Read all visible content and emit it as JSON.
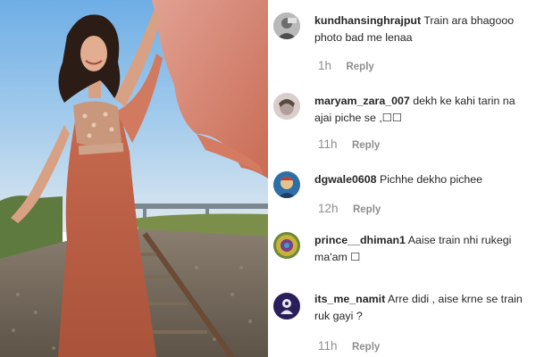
{
  "photo": {
    "description_icon": "woman-in-saree-on-railway-track-photo"
  },
  "comments": [
    {
      "username": "kundhansinghrajput",
      "text": "Train ara bhagooo photo bad me lenaa",
      "time": "1h",
      "reply_label": "Reply",
      "avatar_color": "#9a9a9a"
    },
    {
      "username": "maryam_zara_007",
      "text": "dekh ke kahi tarin na ajai piche se ,☐☐",
      "time": "11h",
      "reply_label": "Reply",
      "avatar_color": "#b8a9a6"
    },
    {
      "username": "dgwale0608",
      "text": "Pichhe dekho pichee",
      "time": "12h",
      "reply_label": "Reply",
      "avatar_color": "#2f6fa8"
    },
    {
      "username": "prince__dhiman1",
      "text": "Aaise train nhi rukegi ma'am ☐",
      "time": "",
      "reply_label": "",
      "avatar_color": "#6a8a3a"
    },
    {
      "username": "its_me_namit",
      "text": "Arre didi , aise krne se train ruk gayi ?",
      "time": "11h",
      "reply_label": "Reply",
      "avatar_color": "#2a1f5a"
    }
  ],
  "colors": {
    "username": "#262626",
    "meta": "#8e8e8e",
    "sky": "#7fb8e6",
    "saree": "#c8654a"
  }
}
